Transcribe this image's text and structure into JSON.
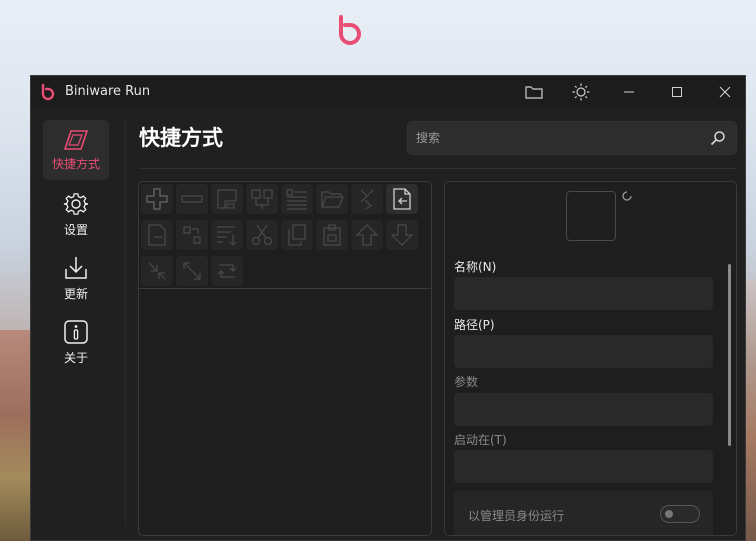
{
  "window": {
    "title": "Biniware Run",
    "accent_color": "#e84d73"
  },
  "titlebar_icons": [
    "folder-icon",
    "theme-sun-icon",
    "minimize-icon",
    "maximize-icon",
    "close-icon"
  ],
  "sidebar": {
    "items": [
      {
        "label": "快捷方式",
        "icon": "shortcuts-icon",
        "active": true
      },
      {
        "label": "设置",
        "icon": "gear-icon",
        "active": false
      },
      {
        "label": "更新",
        "icon": "download-icon",
        "active": false
      },
      {
        "label": "关于",
        "icon": "info-icon",
        "active": false
      }
    ]
  },
  "main": {
    "title": "快捷方式",
    "search_placeholder": "搜索"
  },
  "toolbar": {
    "tools": [
      "add-icon",
      "remove-icon",
      "edit-icon",
      "group-icon",
      "list-icon",
      "open-folder-icon",
      "merge-icon",
      "import-icon",
      "export-icon",
      "move-icon",
      "sort-icon",
      "cut-icon",
      "copy-icon",
      "paste-icon",
      "move-up-icon",
      "move-down-icon",
      "collapse-icon",
      "expand-icon",
      "refresh-icon"
    ]
  },
  "details": {
    "name_label": "名称(N)",
    "path_label": "路径(P)",
    "args_label": "参数",
    "start_in_label": "启动在(T)",
    "run_as_admin_label": "以管理员身份运行",
    "run_as_admin": false
  }
}
